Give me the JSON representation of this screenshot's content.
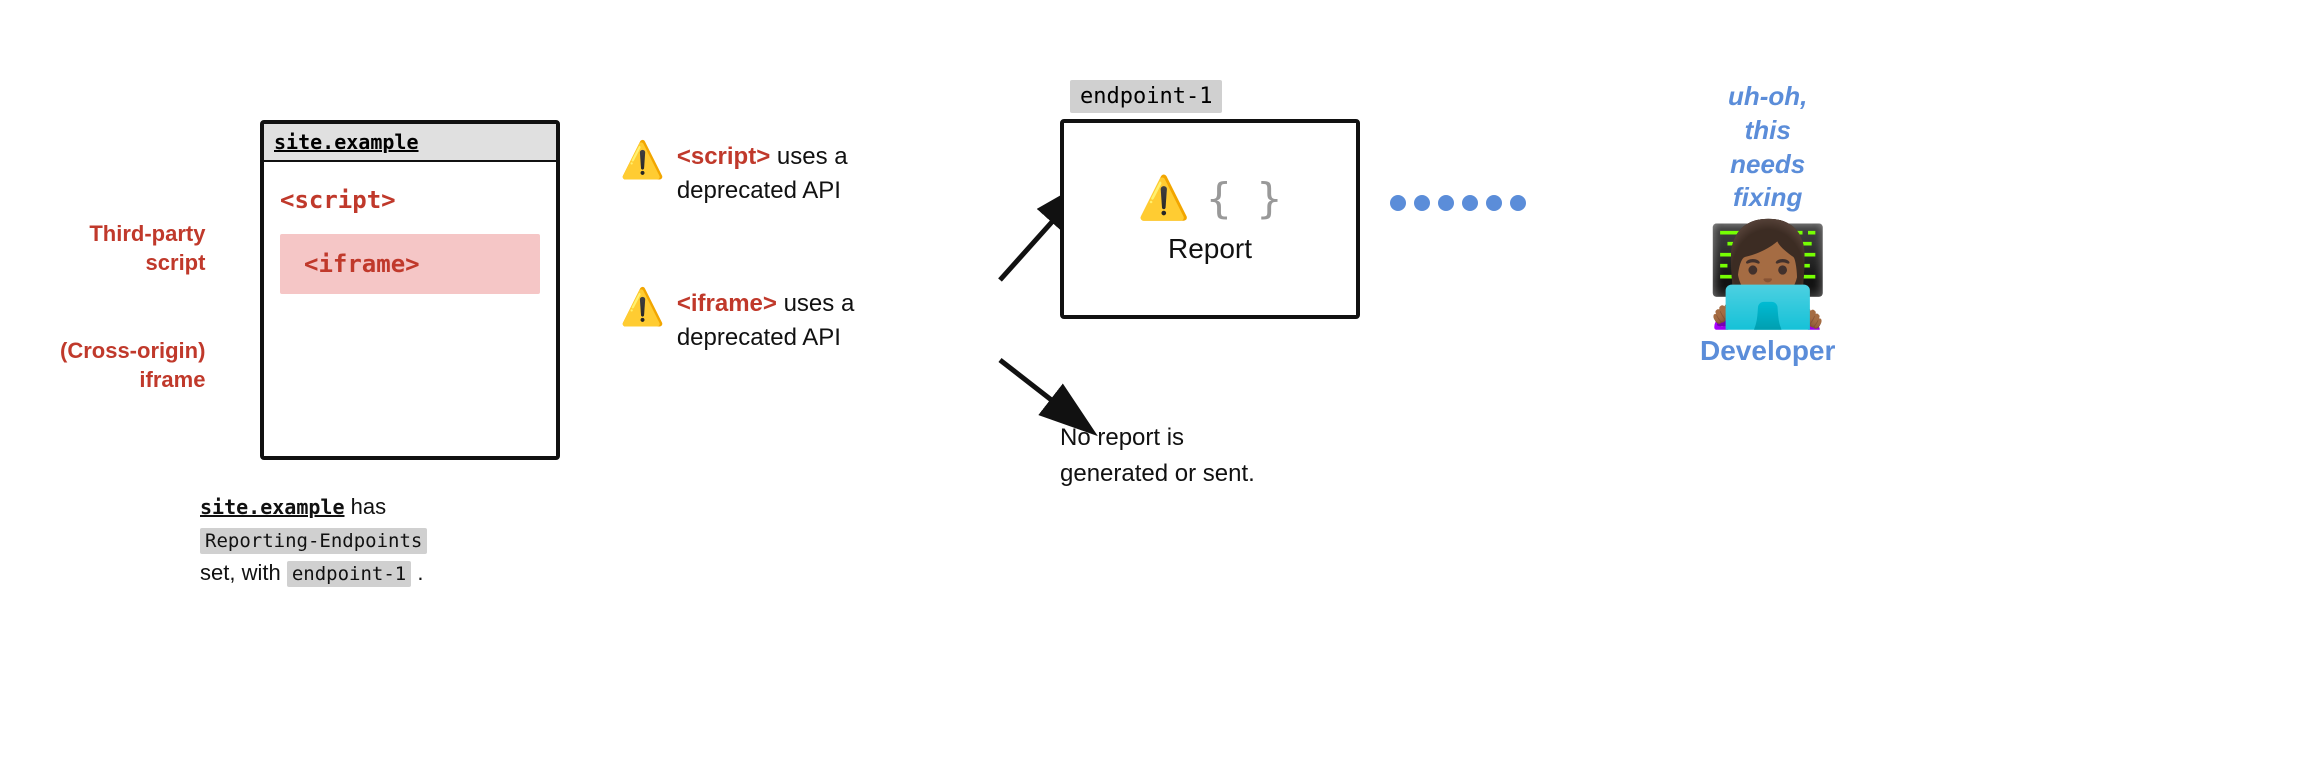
{
  "browser": {
    "titlebar": "site.example",
    "script_tag": "<script>",
    "iframe_tag": "<iframe>"
  },
  "left_labels": {
    "third_party": "Third-party\nscript",
    "cross_origin": "(Cross-origin)\niframe"
  },
  "caption": {
    "part1": "site.example",
    "part2": " has",
    "part3": "Reporting-Endpoints",
    "part4": "set, with ",
    "part5": "endpoint-1",
    "part6": " ."
  },
  "warnings": [
    {
      "icon": "⚠️",
      "tag": "<script>",
      "text": " uses a\ndeprecated API"
    },
    {
      "icon": "⚠️",
      "tag": "<iframe>",
      "text": " uses a\ndeprecated API"
    }
  ],
  "endpoint": {
    "label": "endpoint-1",
    "report_label": "Report"
  },
  "no_report": "No report is\ngenerated or sent.",
  "dots": [
    "●",
    "●",
    "●",
    "●",
    "●",
    "●"
  ],
  "developer": {
    "speech": "uh-oh,\nthis\nneeds\nfixing",
    "emoji": "👩🏾‍💻",
    "label": "Developer"
  },
  "arrows": {
    "up_arrow": "↗",
    "down_arrow": "↘"
  }
}
